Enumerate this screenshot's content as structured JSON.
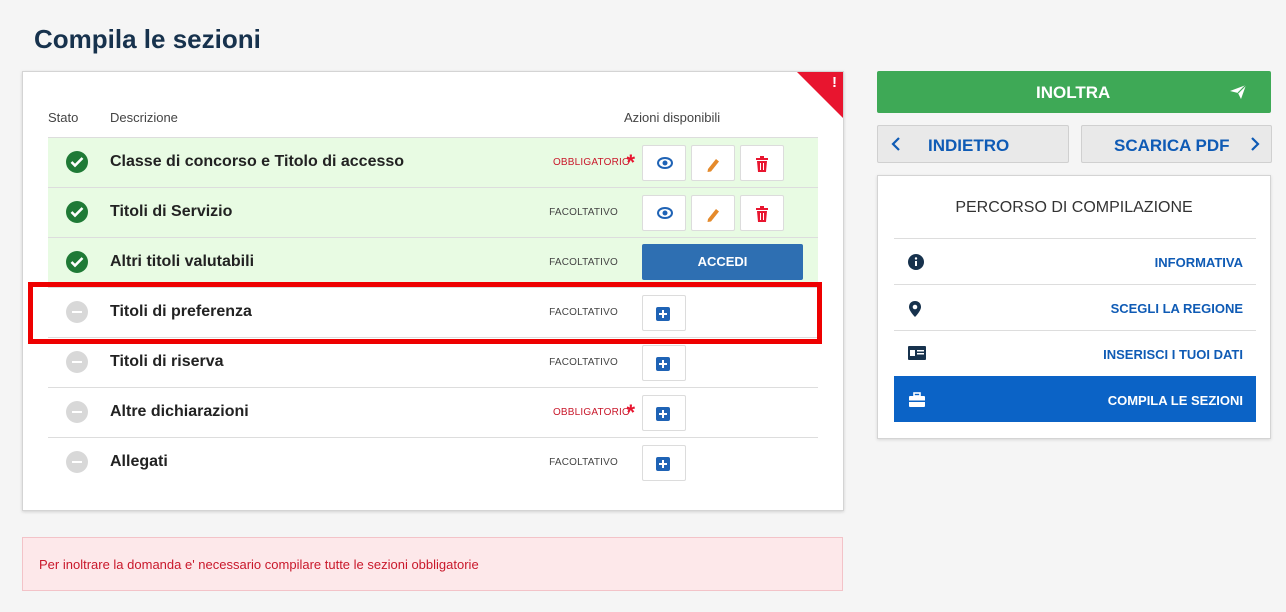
{
  "page": {
    "title": "Compila le sezioni",
    "alert": "Per inoltrare la domanda e' necessario compilare tutte le sezioni obbligatorie"
  },
  "table": {
    "corner_mark": "!",
    "headers": {
      "stato": "Stato",
      "descrizione": "Descrizione",
      "azioni": "Azioni disponibili"
    },
    "rows": [
      {
        "description": "Classe di concorso e Titolo di accesso",
        "tag": "OBBLIGATORIO",
        "required": true,
        "status": "complete"
      },
      {
        "description": "Titoli di Servizio",
        "tag": "FACOLTATIVO",
        "required": false,
        "status": "complete"
      },
      {
        "description": "Altri titoli valutabili",
        "tag": "FACOLTATIVO",
        "required": false,
        "status": "complete",
        "action_label": "ACCEDI"
      },
      {
        "description": "Titoli di preferenza",
        "tag": "FACOLTATIVO",
        "required": false,
        "status": "empty"
      },
      {
        "description": "Titoli di riserva",
        "tag": "FACOLTATIVO",
        "required": false,
        "status": "empty"
      },
      {
        "description": "Altre dichiarazioni",
        "tag": "OBBLIGATORIO",
        "required": true,
        "status": "empty"
      },
      {
        "description": "Allegati",
        "tag": "FACOLTATIVO",
        "required": false,
        "status": "empty"
      }
    ],
    "required_mark": "*"
  },
  "sidebar": {
    "inoltra_label": "INOLTRA",
    "back_label": "INDIETRO",
    "pdf_label": "SCARICA PDF",
    "panel_title": "PERCORSO DI COMPILAZIONE",
    "steps": [
      {
        "label": "INFORMATIVA",
        "icon": "info-icon"
      },
      {
        "label": "SCEGLI LA REGIONE",
        "icon": "map-pin-icon"
      },
      {
        "label": "INSERISCI I TUOI DATI",
        "icon": "id-card-icon"
      },
      {
        "label": "COMPILA LE SEZIONI",
        "icon": "briefcase-icon",
        "active": true
      }
    ]
  },
  "colors": {
    "accent": "#0b63c6",
    "success": "#3ea956",
    "danger": "#e8152f",
    "complete_row": "#e8fbe3"
  }
}
